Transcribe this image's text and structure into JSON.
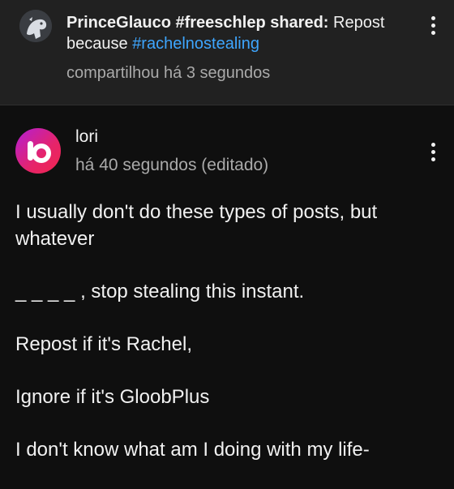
{
  "shared_header": {
    "author": "PrinceGlauco #freeschlep shared:",
    "message": "Repost because",
    "hashtag": "#rachelnostealing",
    "timestamp": "compartilhou há 3 segundos",
    "avatar_icon": "dinosaur-avatar-icon",
    "menu_icon": "more-vert-icon"
  },
  "post": {
    "author": "lori",
    "timestamp": "há 40 segundos (editado)",
    "avatar_icon": "lo-logo-avatar-icon",
    "menu_icon": "more-vert-icon",
    "paragraphs": [
      "I usually don't do these types of posts, but whatever",
      "_ _ _ _ , stop stealing this instant.",
      "Repost if it's Rachel,",
      "Ignore if it's GloobPlus",
      "I don't know what am I doing with my life-"
    ]
  },
  "colors": {
    "background": "#0f0f0f",
    "header_background": "#212121",
    "hashtag": "#3ea6ff",
    "secondary_text": "#aaaaaa",
    "avatar_gradient_start": "#b21fd6",
    "avatar_gradient_end": "#f0264f"
  }
}
